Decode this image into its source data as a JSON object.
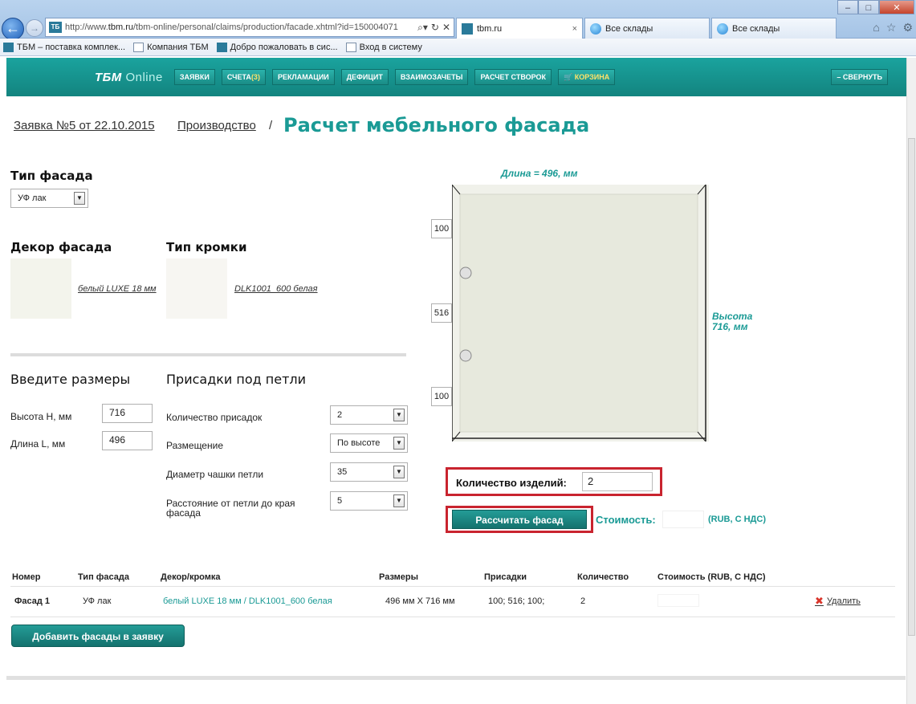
{
  "browser": {
    "url_prefix": "http://www.",
    "url_domain": "tbm.ru",
    "url_rest": "/tbm-online/personal/claims/production/facade.xhtml?id=150004071",
    "addr_search_icon": "search-icon",
    "addr_refresh_icon": "refresh-icon",
    "addr_close_icon": "close-icon",
    "tabs": [
      {
        "label": "tbm.ru",
        "close": "×"
      },
      {
        "label": "Все склады"
      },
      {
        "label": "Все склады"
      }
    ],
    "favorites": [
      "ТБМ – поставка комплек...",
      "Компания ТБМ",
      "Добро пожаловать в сис...",
      "Вход в систему"
    ]
  },
  "sitenav": {
    "logo": "ТБМ",
    "logo_suffix": "Online",
    "items": [
      {
        "label": "ЗАЯВКИ"
      },
      {
        "label": "СЧЕТА",
        "badge": "(3)"
      },
      {
        "label": "РЕКЛАМАЦИИ"
      },
      {
        "label": "ДЕФИЦИТ"
      },
      {
        "label": "ВЗАИМОЗАЧЕТЫ"
      },
      {
        "label": "РАСЧЕТ СТВОРОК"
      },
      {
        "label": "КОРЗИНА"
      }
    ],
    "collapse": "СВЕРНУТЬ"
  },
  "breadcrumb": {
    "order": "Заявка №5 от 22.10.2015",
    "production": "Производство",
    "separator": "/",
    "title": "Расчет мебельного фасада"
  },
  "form": {
    "facade_type_heading": "Тип фасада",
    "facade_type_value": "УФ лак",
    "decor_heading": "Декор фасада",
    "decor_link": "белый LUXE 18 мм",
    "edge_heading": "Тип кромки",
    "edge_link": "DLK1001_600 белая",
    "sizes_heading": "Введите размеры",
    "height_label": "Высота H, мм",
    "height_value": "716",
    "length_label": "Длина L, мм",
    "length_value": "496",
    "hinges_heading": "Присадки под петли",
    "hinge_count_label": "Количество присадок",
    "hinge_count_value": "2",
    "placement_label": "Размещение",
    "placement_value": "По высоте",
    "cup_diameter_label": "Диаметр чашки петли",
    "cup_diameter_value": "35",
    "edge_distance_label": "Расстояние от петли до края фасада",
    "edge_distance_value": "5"
  },
  "preview": {
    "length_label": "Длина = 496, мм",
    "height_label_1": "Высота",
    "height_label_2": "716, мм",
    "offset_top": "100",
    "offset_middle": "516",
    "offset_bottom": "100"
  },
  "calc": {
    "qty_label": "Количество изделий:",
    "qty_value": "2",
    "calc_button": "Рассчитать фасад",
    "cost_label": "Стоимость:",
    "cost_currency": "(RUB, С НДС)"
  },
  "table": {
    "headers": [
      "Номер",
      "Тип фасада",
      "Декор/кромка",
      "Размеры",
      "Присадки",
      "Количество",
      "Стоимость (RUB, С НДС)"
    ],
    "rows": [
      {
        "number": "Фасад 1",
        "type": "УФ лак",
        "decor": "белый LUXE 18 мм / DLK1001_600 белая",
        "size": "496 мм Х 716 мм",
        "hinges": "100; 516; 100;",
        "qty": "2",
        "delete": "Удалить"
      }
    ]
  },
  "add_button": "Добавить фасады в заявку",
  "colors": {
    "accent": "#1a9a95",
    "nav_bg": "#16908c",
    "highlight": "#c9242f"
  }
}
